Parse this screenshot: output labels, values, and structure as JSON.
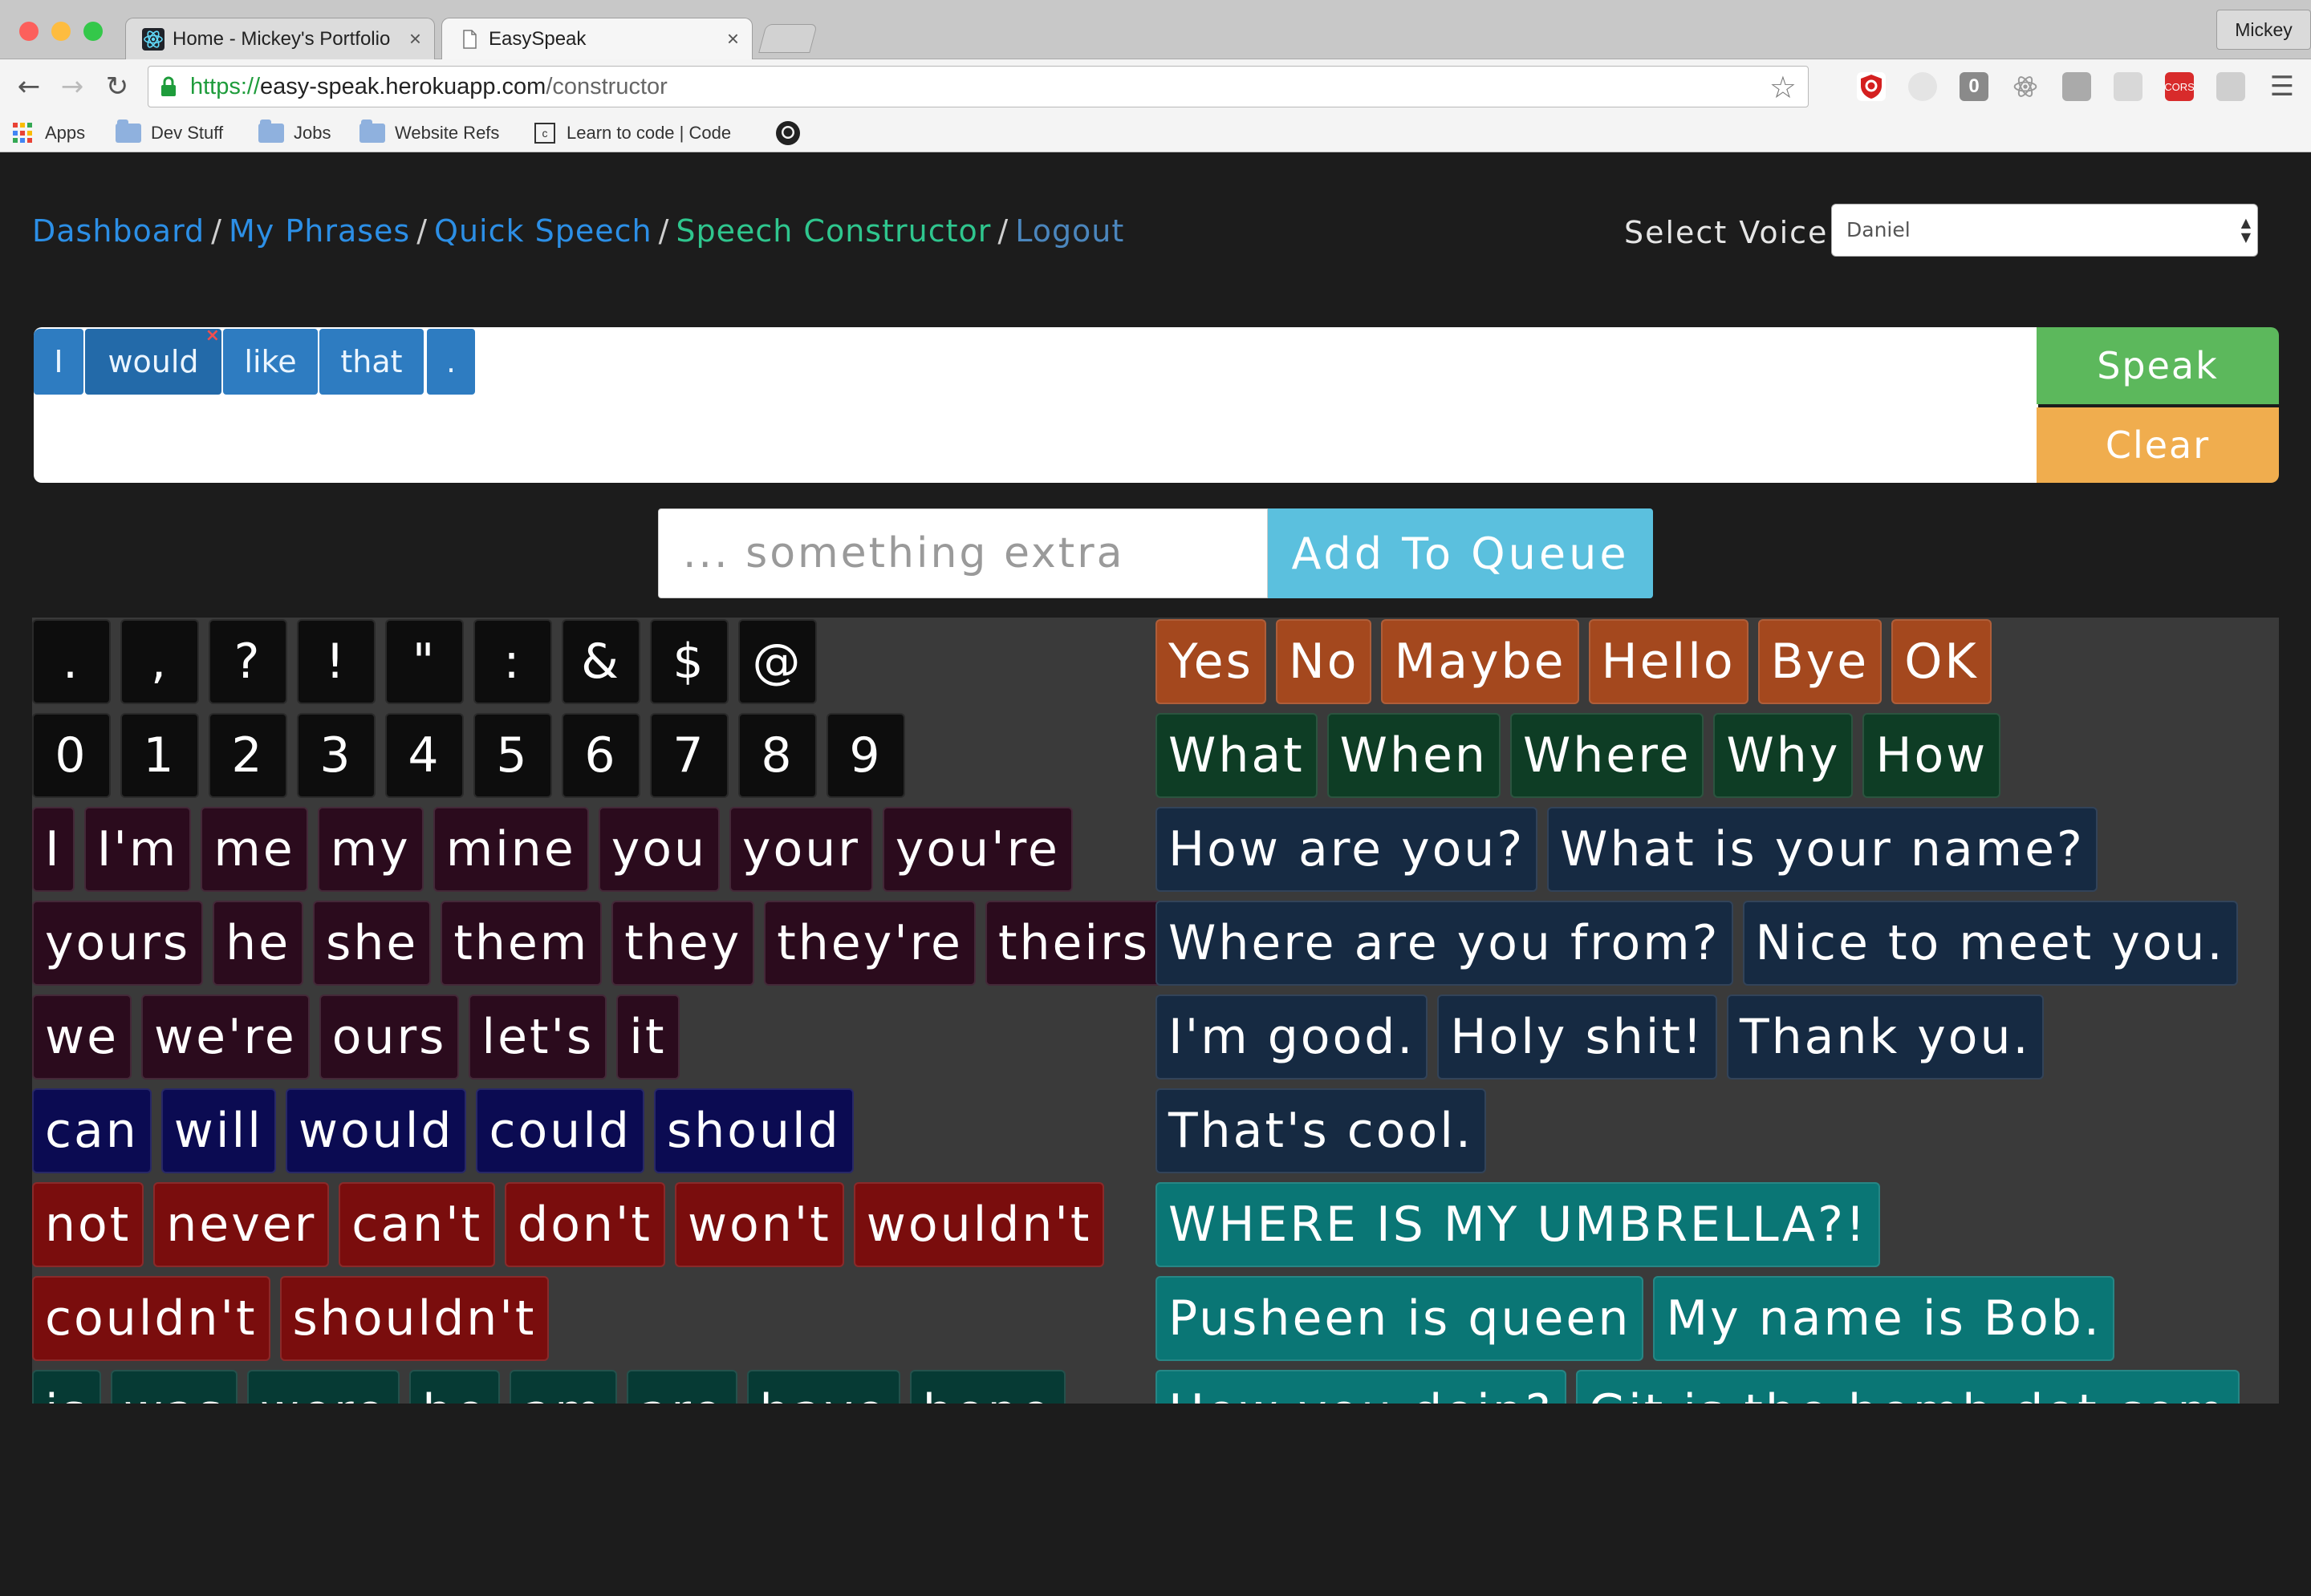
{
  "browser": {
    "tabs": [
      {
        "title": "Home - Mickey's Portfolio"
      },
      {
        "title": "EasySpeak"
      }
    ],
    "profile": "Mickey",
    "url": {
      "scheme": "https://",
      "host": "easy-speak.herokuapp.com",
      "path": "/constructor"
    },
    "bookmarks": [
      "Apps",
      "Dev Stuff",
      "Jobs",
      "Website Refs",
      "Learn to code | Code"
    ],
    "extensions": [
      "ublock-icon",
      "ghost-icon",
      "zero-icon",
      "react-devtools-icon",
      "chrome-ext-icon",
      "paper-icon",
      "cors-icon",
      "plugin-icon"
    ],
    "cors_label": "CORS"
  },
  "nav": {
    "items": [
      "Dashboard",
      "My Phrases",
      "Quick Speech",
      "Speech Constructor",
      "Logout"
    ],
    "separator": "/",
    "active_color": "#2fc68e",
    "link_color": "#2c8fe6"
  },
  "voice": {
    "label": "Select Voice",
    "selected": "Daniel"
  },
  "queue": {
    "words": [
      "I",
      "would",
      "like",
      "that",
      "."
    ],
    "remove_icon": "×"
  },
  "actions": {
    "speak": "Speak",
    "clear": "Clear",
    "speak_color": "#5cb85c",
    "clear_color": "#f0ad4e"
  },
  "extra": {
    "placeholder": "... something extra",
    "button": "Add To Queue",
    "button_color": "#5bc0de"
  },
  "left_groups": [
    {
      "category": "punctuation",
      "color": "#0d0d0d",
      "words": [
        ".",
        ",",
        "?",
        "!",
        "\"",
        ":",
        "&",
        "$",
        "@"
      ]
    },
    {
      "category": "numbers",
      "color": "#0d0d0d",
      "words": [
        "0",
        "1",
        "2",
        "3",
        "4",
        "5",
        "6",
        "7",
        "8",
        "9"
      ]
    },
    {
      "category": "pronouns",
      "color": "#2b0b1d",
      "words": [
        "I",
        "I'm",
        "me",
        "my",
        "mine",
        "you",
        "your",
        "you're"
      ]
    },
    {
      "category": "pronouns",
      "color": "#2b0b1d",
      "words": [
        "yours",
        "he",
        "she",
        "them",
        "they",
        "they're",
        "theirs"
      ]
    },
    {
      "category": "pronouns",
      "color": "#2b0b1d",
      "words": [
        "we",
        "we're",
        "ours",
        "let's",
        "it"
      ]
    },
    {
      "category": "modals",
      "color": "#0b0b52",
      "words": [
        "can",
        "will",
        "would",
        "could",
        "should"
      ]
    },
    {
      "category": "negatives",
      "color": "#7a0d0d",
      "words": [
        "not",
        "never",
        "can't",
        "don't",
        "won't",
        "wouldn't"
      ]
    },
    {
      "category": "negatives",
      "color": "#7a0d0d",
      "words": [
        "couldn't",
        "shouldn't"
      ]
    },
    {
      "category": "verbs",
      "color": "#063a34",
      "words": [
        "is",
        "was",
        "were",
        "be",
        "am",
        "are",
        "have",
        "hope"
      ]
    }
  ],
  "right_groups": [
    {
      "category": "basic",
      "color": "#a4481e",
      "words": [
        "Yes",
        "No",
        "Maybe",
        "Hello",
        "Bye",
        "OK"
      ]
    },
    {
      "category": "questions",
      "color": "#0e3d25",
      "words": [
        "What",
        "When",
        "Where",
        "Why",
        "How"
      ]
    },
    {
      "category": "phrases",
      "color": "#162a42",
      "words": [
        "How are you?",
        "What is your name?"
      ]
    },
    {
      "category": "phrases",
      "color": "#162a42",
      "words": [
        "Where are you from?",
        "Nice to meet you."
      ]
    },
    {
      "category": "phrases",
      "color": "#162a42",
      "words": [
        "I'm good.",
        "Holy shit!",
        "Thank you."
      ]
    },
    {
      "category": "phrases",
      "color": "#162a42",
      "words": [
        "That's cool."
      ]
    },
    {
      "category": "custom",
      "color": "#0a7675",
      "words": [
        "WHERE IS MY UMBRELLA?!"
      ]
    },
    {
      "category": "custom",
      "color": "#0a7675",
      "words": [
        "Pusheen is queen",
        "My name is Bob."
      ]
    },
    {
      "category": "custom",
      "color": "#0a7675",
      "words": [
        "How you doin?",
        "Git is the bomb dot com"
      ]
    }
  ]
}
